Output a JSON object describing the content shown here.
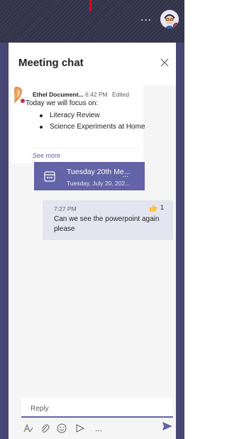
{
  "window": {
    "more_label": "...",
    "red_mark_color": "#e0001b"
  },
  "header": {
    "title": "Meeting chat",
    "close_icon": "close-icon"
  },
  "message": {
    "author": "Ethel Document...",
    "time": "6:42 PM",
    "edited": "Edited",
    "intro": "Today we will focus on:",
    "bullets": [
      "Literacy Review",
      "Science Experiments at Home"
    ],
    "see_more": "See more"
  },
  "meeting_card": {
    "title": "Tuesday 20th Me...",
    "subtitle": "Tuesday, July 20, 202...",
    "more_label": "..."
  },
  "reply_message": {
    "time": "7:27 PM",
    "reaction_count": "1",
    "text": "Can we see the powerpoint again please"
  },
  "compose": {
    "placeholder": "Reply",
    "more_label": "..."
  },
  "colors": {
    "topbar": "#33344a",
    "side": "#464775",
    "accent": "#6264a7",
    "status_busy": "#c4314b"
  }
}
